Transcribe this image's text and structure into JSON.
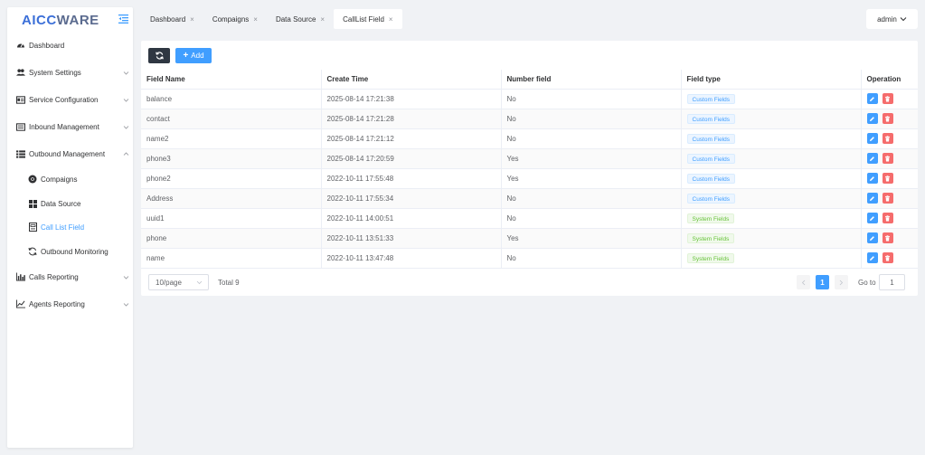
{
  "logo": {
    "part1": "AICC",
    "part2": "WARE"
  },
  "sidebar": {
    "items": [
      {
        "label": "Dashboard",
        "icon": "tachometer-icon"
      },
      {
        "label": "System Settings",
        "icon": "users-icon"
      },
      {
        "label": "Service Configuration",
        "icon": "id-card-icon"
      },
      {
        "label": "Inbound Management",
        "icon": "inbox-list-icon"
      },
      {
        "label": "Outbound Management",
        "icon": "list-icon",
        "expanded": true
      },
      {
        "label": "Calls Reporting",
        "icon": "bar-chart-icon"
      },
      {
        "label": "Agents Reporting",
        "icon": "line-chart-icon"
      }
    ],
    "subitems": [
      {
        "label": "Compaigns",
        "icon": "chrome-icon"
      },
      {
        "label": "Data Source",
        "icon": "grid-icon"
      },
      {
        "label": "Call List Field",
        "icon": "form-icon",
        "active": true
      },
      {
        "label": "Outbound Monitoring",
        "icon": "refresh-icon"
      }
    ]
  },
  "tabs": [
    {
      "label": "Dashboard"
    },
    {
      "label": "Compaigns"
    },
    {
      "label": "Data Source"
    },
    {
      "label": "CallList Field",
      "active": true
    }
  ],
  "user": {
    "name": "admin"
  },
  "toolbar": {
    "add_label": "Add"
  },
  "table": {
    "columns": [
      "Field Name",
      "Create Time",
      "Number field",
      "Field type",
      "Operation"
    ],
    "rows": [
      {
        "name": "balance",
        "time": "2025-08-14 17:21:38",
        "number": "No",
        "type": "Custom Fields"
      },
      {
        "name": "contact",
        "time": "2025-08-14 17:21:28",
        "number": "No",
        "type": "Custom Fields"
      },
      {
        "name": "name2",
        "time": "2025-08-14 17:21:12",
        "number": "No",
        "type": "Custom Fields"
      },
      {
        "name": "phone3",
        "time": "2025-08-14 17:20:59",
        "number": "Yes",
        "type": "Custom Fields"
      },
      {
        "name": "phone2",
        "time": "2022-10-11 17:55:48",
        "number": "Yes",
        "type": "Custom Fields"
      },
      {
        "name": "Address",
        "time": "2022-10-11 17:55:34",
        "number": "No",
        "type": "Custom Fields"
      },
      {
        "name": "uuid1",
        "time": "2022-10-11 14:00:51",
        "number": "No",
        "type": "System Fields"
      },
      {
        "name": "phone",
        "time": "2022-10-11 13:51:33",
        "number": "Yes",
        "type": "System Fields"
      },
      {
        "name": "name",
        "time": "2022-10-11 13:47:48",
        "number": "No",
        "type": "System Fields"
      }
    ]
  },
  "pagination": {
    "page_size": "10/page",
    "total": "Total 9",
    "current": "1",
    "goto_label": "Go to",
    "goto_value": "1"
  },
  "colors": {
    "primary": "#409eff",
    "danger": "#f56c6c",
    "success": "#67c23a",
    "dark": "#2f3742"
  }
}
